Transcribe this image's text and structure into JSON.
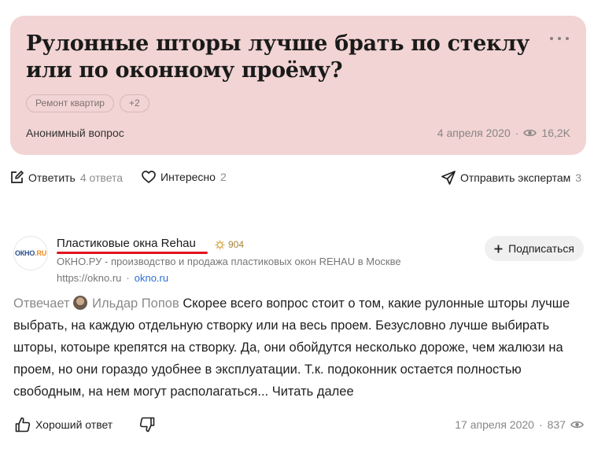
{
  "question": {
    "title": "Рулонные шторы лучше брать по стеклу или по оконному проёму?",
    "tags": [
      "Ремонт квартир",
      "+2"
    ],
    "author": "Анонимный вопрос",
    "date": "4 апреля 2020",
    "separator": "·",
    "views": "16,2K"
  },
  "actions": {
    "answer_label": "Ответить",
    "answer_count": "4 ответа",
    "interesting_label": "Интересно",
    "interesting_count": "2",
    "send_label": "Отправить экспертам",
    "send_count": "3"
  },
  "answer": {
    "org_name": "Пластиковые окна Rehau",
    "rating": "904",
    "org_description": "ОКНО.РУ - производство и продажа пластиковых окон REHAU в Москве",
    "org_url": "https://okno.ru",
    "separator": "·",
    "org_link": "okno.ru",
    "logo_text_main": "ОКНО",
    "logo_text_accent": ".RU",
    "subscribe_label": "Подписаться",
    "replies_label": "Отвечает",
    "person": "Ильдар Попов",
    "text": "Скорее всего вопрос стоит о том, какие рулонные шторы лучше выбрать, на каждую отдельную створку или на весь проем. Безусловно лучше выбирать шторы, котоыре крепятся на створку. Да, они обойдутся несколько дороже, чем жалюзи на проем, но они гораздо удобнее в эксплуатации. Т.к. подоконник остается полностью свободным, на нем могут располагаться...",
    "read_more": "Читать далее",
    "good_answer_label": "Хороший ответ",
    "date": "17 апреля 2020",
    "views": "837"
  },
  "colors": {
    "card_bg": "#f2d4d4",
    "link": "#2b6fd6",
    "underline": "#e0141e",
    "rating": "#a88436"
  }
}
